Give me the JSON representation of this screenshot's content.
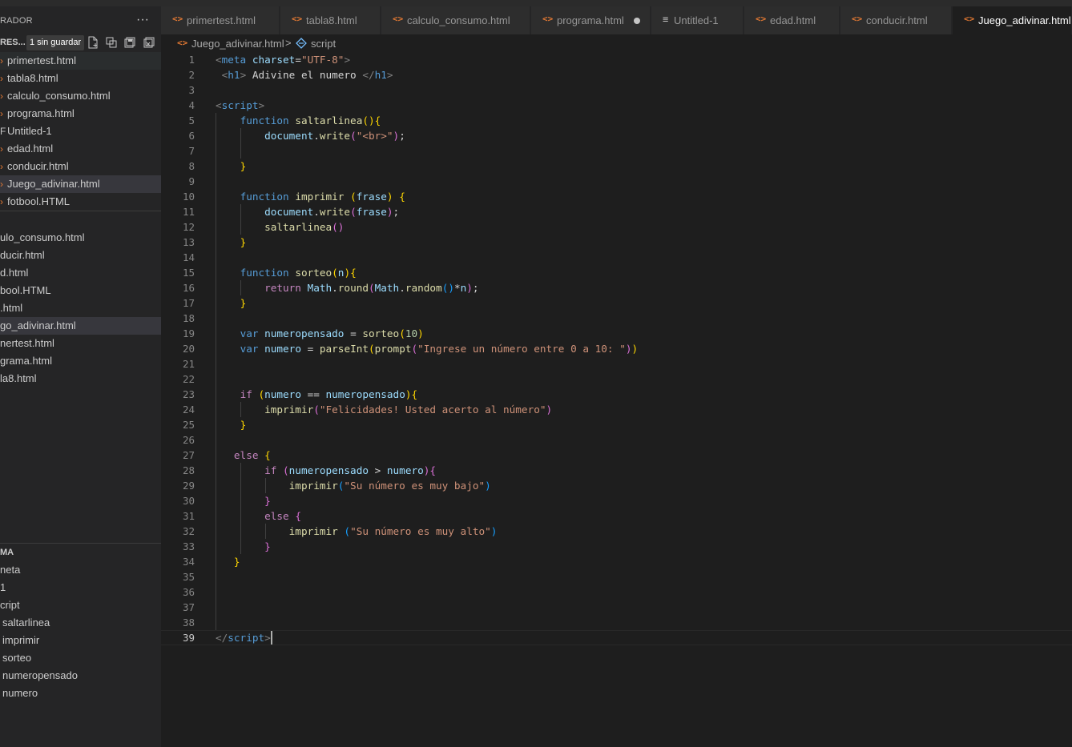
{
  "explorer": {
    "title": "RADOR",
    "more": "···",
    "open_editors_title": "RES...",
    "unsaved_badge": "1 sin guardar",
    "open_editors": [
      {
        "mark": "›",
        "label": "primertest.html"
      },
      {
        "mark": "›",
        "label": "tabla8.html"
      },
      {
        "mark": "›",
        "label": "calculo_consumo.html"
      },
      {
        "mark": "›",
        "label": "programa.html"
      },
      {
        "mark": "F",
        "label": "Untitled-1"
      },
      {
        "mark": "›",
        "label": "edad.html"
      },
      {
        "mark": "›",
        "label": "conducir.html"
      },
      {
        "mark": "›",
        "label": "Juego_adivinar.html"
      },
      {
        "mark": "›",
        "label": "fotbool.HTML"
      }
    ],
    "folder_files": [
      "ulo_consumo.html",
      "ducir.html",
      "d.html",
      "bool.HTML",
      ".html",
      "go_adivinar.html",
      "nertest.html",
      "grama.html",
      "la8.html"
    ],
    "outline_title": "MA",
    "outline_items": [
      "neta",
      "1",
      "cript",
      "saltarlinea",
      "imprimir",
      "sorteo",
      "numeropensado",
      "numero"
    ]
  },
  "tabs": [
    {
      "icon": "<>",
      "label": "primertest.html"
    },
    {
      "icon": "<>",
      "label": "tabla8.html"
    },
    {
      "icon": "<>",
      "label": "calculo_consumo.html"
    },
    {
      "icon": "<>",
      "label": "programa.html"
    },
    {
      "icon": "≡",
      "label": "Untitled-1"
    },
    {
      "icon": "<>",
      "label": "edad.html"
    },
    {
      "icon": "<>",
      "label": "conducir.html"
    },
    {
      "icon": "<>",
      "label": "Juego_adivinar.html"
    }
  ],
  "breadcrumb": {
    "icon": "<>",
    "file": "Juego_adivinar.html",
    "separator": ">",
    "symbol": "script"
  },
  "colors": {
    "tag": "#808080",
    "tagname": "#569cd6",
    "attr": "#9cdcfe",
    "string": "#ce9178",
    "keyword": "#569cd6",
    "control": "#c586c0",
    "func": "#dcdcaa",
    "var": "#9cdcfe",
    "number": "#b5cea8",
    "text": "#d4d4d4",
    "bracket1": "#ffd700",
    "bracket2": "#da70d6",
    "bracket3": "#179fff",
    "file_icon": "#e37933"
  },
  "code_lines": [
    [
      [
        "<",
        "tag"
      ],
      [
        "meta",
        "tagname"
      ],
      [
        " ",
        "text"
      ],
      [
        "charset",
        "attr"
      ],
      [
        "=",
        "text"
      ],
      [
        "\"UTF-8\"",
        "string"
      ],
      [
        ">",
        "tag"
      ]
    ],
    [
      [
        " ",
        "text"
      ],
      [
        "<",
        "tag"
      ],
      [
        "h1",
        "tagname"
      ],
      [
        ">",
        "tag"
      ],
      [
        " Adivine el numero ",
        "text"
      ],
      [
        "</",
        "tag"
      ],
      [
        "h1",
        "tagname"
      ],
      [
        ">",
        "tag"
      ]
    ],
    [],
    [
      [
        "<",
        "tag"
      ],
      [
        "script",
        "tagname"
      ],
      [
        ">",
        "tag"
      ]
    ],
    [
      [
        "    ",
        "text"
      ],
      [
        "function",
        "keyword"
      ],
      [
        " ",
        "text"
      ],
      [
        "saltarlinea",
        "func"
      ],
      [
        "()",
        "bracket1"
      ],
      [
        "{",
        "bracket1"
      ]
    ],
    [
      [
        "        ",
        "text"
      ],
      [
        "document",
        "var"
      ],
      [
        ".",
        "text"
      ],
      [
        "write",
        "func"
      ],
      [
        "(",
        "bracket2"
      ],
      [
        "\"<br>\"",
        "string"
      ],
      [
        ")",
        "bracket2"
      ],
      [
        ";",
        "text"
      ]
    ],
    [],
    [
      [
        "    ",
        "text"
      ],
      [
        "}",
        "bracket1"
      ]
    ],
    [],
    [
      [
        "    ",
        "text"
      ],
      [
        "function",
        "keyword"
      ],
      [
        " ",
        "text"
      ],
      [
        "imprimir",
        "func"
      ],
      [
        " ",
        "text"
      ],
      [
        "(",
        "bracket1"
      ],
      [
        "frase",
        "var"
      ],
      [
        ")",
        "bracket1"
      ],
      [
        " ",
        "text"
      ],
      [
        "{",
        "bracket1"
      ]
    ],
    [
      [
        "        ",
        "text"
      ],
      [
        "document",
        "var"
      ],
      [
        ".",
        "text"
      ],
      [
        "write",
        "func"
      ],
      [
        "(",
        "bracket2"
      ],
      [
        "frase",
        "var"
      ],
      [
        ")",
        "bracket2"
      ],
      [
        ";",
        "text"
      ]
    ],
    [
      [
        "        ",
        "text"
      ],
      [
        "saltarlinea",
        "func"
      ],
      [
        "()",
        "bracket2"
      ]
    ],
    [
      [
        "    ",
        "text"
      ],
      [
        "}",
        "bracket1"
      ]
    ],
    [],
    [
      [
        "    ",
        "text"
      ],
      [
        "function",
        "keyword"
      ],
      [
        " ",
        "text"
      ],
      [
        "sorteo",
        "func"
      ],
      [
        "(",
        "bracket1"
      ],
      [
        "n",
        "var"
      ],
      [
        ")",
        "bracket1"
      ],
      [
        "{",
        "bracket1"
      ]
    ],
    [
      [
        "        ",
        "text"
      ],
      [
        "return",
        "control"
      ],
      [
        " ",
        "text"
      ],
      [
        "Math",
        "var"
      ],
      [
        ".",
        "text"
      ],
      [
        "round",
        "func"
      ],
      [
        "(",
        "bracket2"
      ],
      [
        "Math",
        "var"
      ],
      [
        ".",
        "text"
      ],
      [
        "random",
        "func"
      ],
      [
        "()",
        "bracket3"
      ],
      [
        "*",
        "text"
      ],
      [
        "n",
        "var"
      ],
      [
        ")",
        "bracket2"
      ],
      [
        ";",
        "text"
      ]
    ],
    [
      [
        "    ",
        "text"
      ],
      [
        "}",
        "bracket1"
      ]
    ],
    [],
    [
      [
        "    ",
        "text"
      ],
      [
        "var",
        "keyword"
      ],
      [
        " ",
        "text"
      ],
      [
        "numeropensado",
        "var"
      ],
      [
        " = ",
        "text"
      ],
      [
        "sorteo",
        "func"
      ],
      [
        "(",
        "bracket1"
      ],
      [
        "10",
        "number"
      ],
      [
        ")",
        "bracket1"
      ]
    ],
    [
      [
        "    ",
        "text"
      ],
      [
        "var",
        "keyword"
      ],
      [
        " ",
        "text"
      ],
      [
        "numero",
        "var"
      ],
      [
        " = ",
        "text"
      ],
      [
        "parseInt",
        "func"
      ],
      [
        "(",
        "bracket1"
      ],
      [
        "prompt",
        "func"
      ],
      [
        "(",
        "bracket2"
      ],
      [
        "\"Ingrese un número entre 0 a 10: \"",
        "string"
      ],
      [
        ")",
        "bracket2"
      ],
      [
        ")",
        "bracket1"
      ]
    ],
    [],
    [],
    [
      [
        "    ",
        "text"
      ],
      [
        "if",
        "control"
      ],
      [
        " ",
        "text"
      ],
      [
        "(",
        "bracket1"
      ],
      [
        "numero",
        "var"
      ],
      [
        " == ",
        "text"
      ],
      [
        "numeropensado",
        "var"
      ],
      [
        ")",
        "bracket1"
      ],
      [
        "{",
        "bracket1"
      ]
    ],
    [
      [
        "        ",
        "text"
      ],
      [
        "imprimir",
        "func"
      ],
      [
        "(",
        "bracket2"
      ],
      [
        "\"Felicidades! Usted acerto al número\"",
        "string"
      ],
      [
        ")",
        "bracket2"
      ]
    ],
    [
      [
        "    ",
        "text"
      ],
      [
        "}",
        "bracket1"
      ]
    ],
    [],
    [
      [
        "   ",
        "text"
      ],
      [
        "else",
        "control"
      ],
      [
        " ",
        "text"
      ],
      [
        "{",
        "bracket1"
      ]
    ],
    [
      [
        "        ",
        "text"
      ],
      [
        "if",
        "control"
      ],
      [
        " ",
        "text"
      ],
      [
        "(",
        "bracket2"
      ],
      [
        "numeropensado",
        "var"
      ],
      [
        " > ",
        "text"
      ],
      [
        "numero",
        "var"
      ],
      [
        ")",
        "bracket2"
      ],
      [
        "{",
        "bracket2"
      ]
    ],
    [
      [
        "            ",
        "text"
      ],
      [
        "imprimir",
        "func"
      ],
      [
        "(",
        "bracket3"
      ],
      [
        "\"Su número es muy bajo\"",
        "string"
      ],
      [
        ")",
        "bracket3"
      ]
    ],
    [
      [
        "        ",
        "text"
      ],
      [
        "}",
        "bracket2"
      ]
    ],
    [
      [
        "        ",
        "text"
      ],
      [
        "else",
        "control"
      ],
      [
        " ",
        "text"
      ],
      [
        "{",
        "bracket2"
      ]
    ],
    [
      [
        "            ",
        "text"
      ],
      [
        "imprimir",
        "func"
      ],
      [
        " ",
        "text"
      ],
      [
        "(",
        "bracket3"
      ],
      [
        "\"Su número es muy alto\"",
        "string"
      ],
      [
        ")",
        "bracket3"
      ]
    ],
    [
      [
        "        ",
        "text"
      ],
      [
        "}",
        "bracket2"
      ]
    ],
    [
      [
        "   ",
        "text"
      ],
      [
        "}",
        "bracket1"
      ]
    ],
    [],
    [],
    [],
    [],
    [
      [
        "</",
        "tag"
      ],
      [
        "script",
        "tagname"
      ],
      [
        ">",
        "tag"
      ]
    ]
  ],
  "current_line": 39
}
